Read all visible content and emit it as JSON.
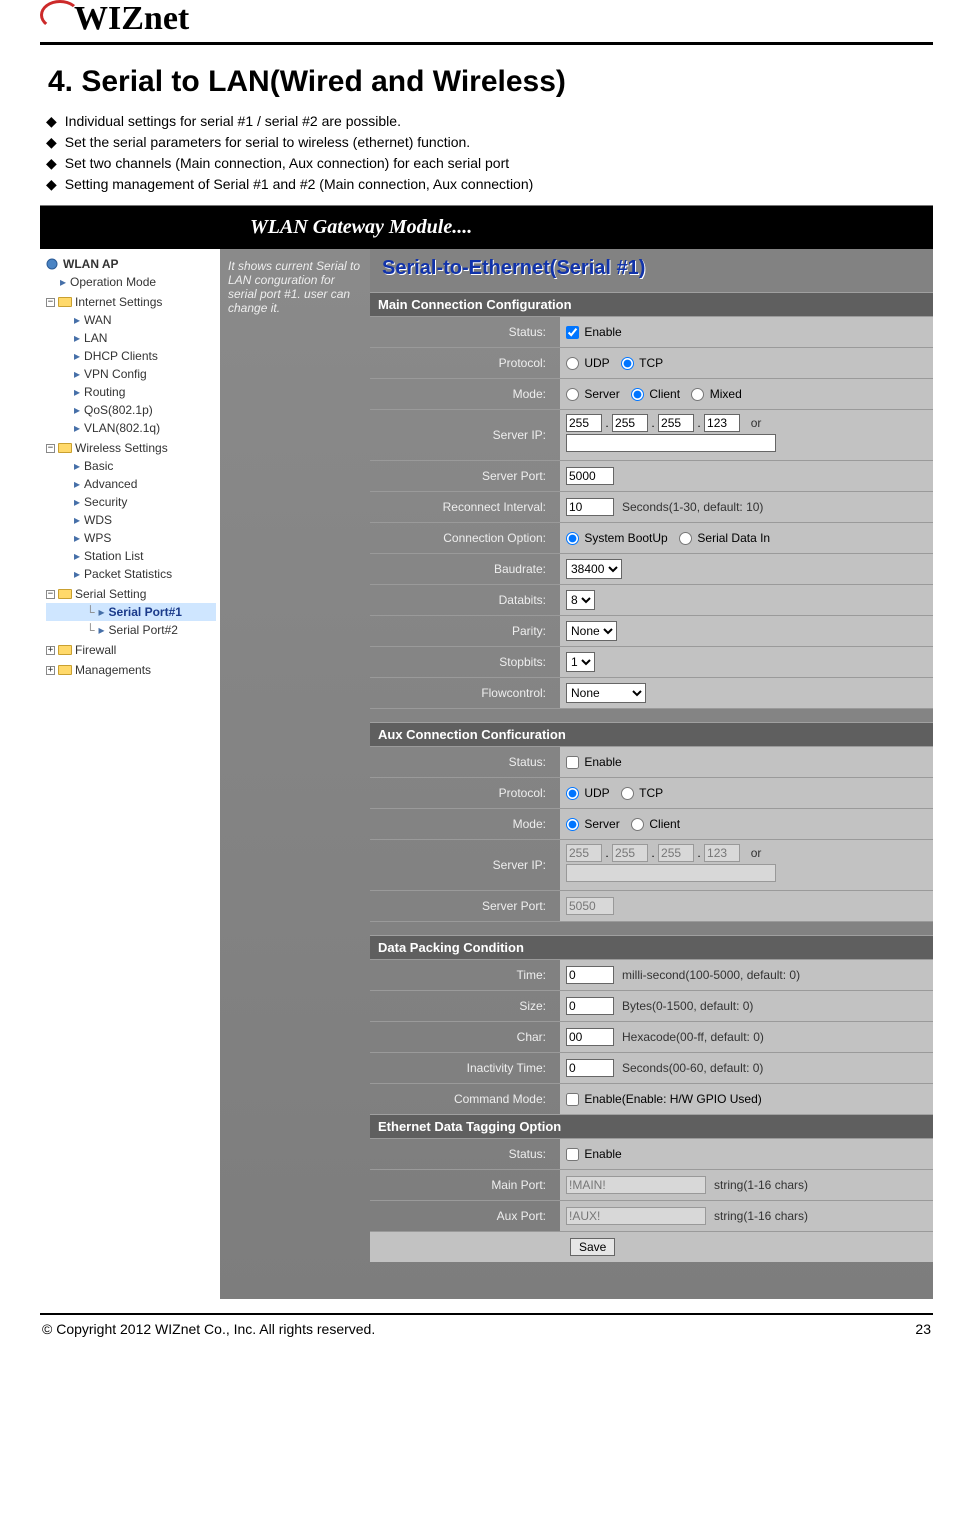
{
  "doc": {
    "logo_text": "WIZnet",
    "section_title": "4. Serial to LAN(Wired and Wireless)",
    "bullets": [
      "Individual settings for serial #1 / serial #2 are possible.",
      "Set the serial parameters for serial to wireless (ethernet) function.",
      "Set two channels (Main connection, Aux connection) for each serial port",
      "Setting management of Serial #1 and #2 (Main connection, Aux connection)"
    ],
    "copyright": "© Copyright 2012 WIZnet Co., Inc. All rights reserved.",
    "page_number": "23"
  },
  "ui": {
    "header": "WLAN Gateway Module....",
    "help_text": "It shows current Serial to LAN conguration for serial port #1. user can change it.",
    "page_title": "Serial-to-Ethernet(Serial #1)",
    "nav": {
      "root": "WLAN AP",
      "operation_mode": "Operation Mode",
      "internet": {
        "label": "Internet Settings",
        "items": [
          "WAN",
          "LAN",
          "DHCP Clients",
          "VPN Config",
          "Routing",
          "QoS(802.1p)",
          "VLAN(802.1q)"
        ]
      },
      "wireless": {
        "label": "Wireless Settings",
        "items": [
          "Basic",
          "Advanced",
          "Security",
          "WDS",
          "WPS",
          "Station List",
          "Packet Statistics"
        ]
      },
      "serial": {
        "label": "Serial Setting",
        "items": [
          "Serial Port#1",
          "Serial Port#2"
        ]
      },
      "firewall": "Firewall",
      "managements": "Managements"
    },
    "main": {
      "header": "Main Connection Configuration",
      "status": {
        "label": "Status:",
        "enable": "Enable",
        "checked": true
      },
      "protocol": {
        "label": "Protocol:",
        "options": [
          "UDP",
          "TCP"
        ],
        "value": "TCP"
      },
      "mode": {
        "label": "Mode:",
        "options": [
          "Server",
          "Client",
          "Mixed"
        ],
        "value": "Client"
      },
      "server_ip": {
        "label": "Server IP:",
        "octets": [
          "255",
          "255",
          "255",
          "123"
        ],
        "or": "or",
        "alt": ""
      },
      "server_port": {
        "label": "Server Port:",
        "value": "5000"
      },
      "reconnect": {
        "label": "Reconnect Interval:",
        "value": "10",
        "note": "Seconds(1-30, default: 10)"
      },
      "con_option": {
        "label": "Connection Option:",
        "options": [
          "System BootUp",
          "Serial Data In"
        ],
        "value": "System BootUp"
      },
      "baudrate": {
        "label": "Baudrate:",
        "value": "38400"
      },
      "databits": {
        "label": "Databits:",
        "value": "8"
      },
      "parity": {
        "label": "Parity:",
        "value": "None"
      },
      "stopbits": {
        "label": "Stopbits:",
        "value": "1"
      },
      "flowcontrol": {
        "label": "Flowcontrol:",
        "value": "None"
      }
    },
    "aux": {
      "header": "Aux Connection Conficuration",
      "status": {
        "label": "Status:",
        "enable": "Enable",
        "checked": false
      },
      "protocol": {
        "label": "Protocol:",
        "options": [
          "UDP",
          "TCP"
        ],
        "value": "UDP"
      },
      "mode": {
        "label": "Mode:",
        "options": [
          "Server",
          "Client"
        ],
        "value": "Server"
      },
      "server_ip": {
        "label": "Server IP:",
        "octets": [
          "255",
          "255",
          "255",
          "123"
        ],
        "or": "or",
        "alt": ""
      },
      "server_port": {
        "label": "Server Port:",
        "value": "5050"
      }
    },
    "pack": {
      "header": "Data Packing Condition",
      "time": {
        "label": "Time:",
        "value": "0",
        "note": "milli-second(100-5000, default: 0)"
      },
      "size": {
        "label": "Size:",
        "value": "0",
        "note": "Bytes(0-1500, default: 0)"
      },
      "char": {
        "label": "Char:",
        "value": "00",
        "note": "Hexacode(00-ff, default: 0)"
      },
      "inactivity": {
        "label": "Inactivity Time:",
        "value": "0",
        "note": "Seconds(00-60, default: 0)"
      },
      "cmd": {
        "label": "Command Mode:",
        "enable": "Enable(Enable: H/W GPIO Used)",
        "checked": false
      }
    },
    "tag": {
      "header": "Ethernet Data Tagging Option",
      "status": {
        "label": "Status:",
        "enable": "Enable",
        "checked": false
      },
      "main_port": {
        "label": "Main Port:",
        "value": "!MAIN!",
        "note": "string(1-16 chars)"
      },
      "aux_port": {
        "label": "Aux Port:",
        "value": "!AUX!",
        "note": "string(1-16 chars)"
      }
    },
    "save": "Save"
  }
}
